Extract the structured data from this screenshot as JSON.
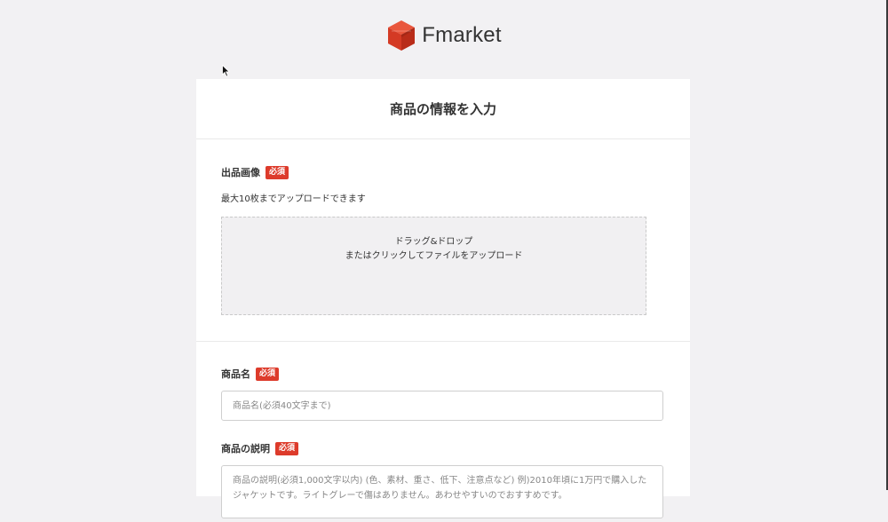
{
  "brand": {
    "name": "Fmarket",
    "logo_color": "#dd3b2b"
  },
  "form": {
    "title": "商品の情報を入力",
    "required_badge": "必須",
    "images": {
      "label": "出品画像",
      "note": "最大10枚までアップロードできます",
      "dropzone_line1": "ドラッグ&ドロップ",
      "dropzone_line2": "またはクリックしてファイルをアップロード"
    },
    "name": {
      "label": "商品名",
      "placeholder": "商品名(必須40文字まで)"
    },
    "description": {
      "label": "商品の説明",
      "placeholder": "商品の説明(必須1,000文字以内) (色、素材、重さ、低下、注意点など) 例)2010年頃に1万円で購入したジャケットです。ライトグレーで傷はありません。あわせやすいのでおすすめです。"
    }
  },
  "colors": {
    "background": "#f2f1f3",
    "required": "#dd3b2b",
    "card": "#ffffff"
  }
}
